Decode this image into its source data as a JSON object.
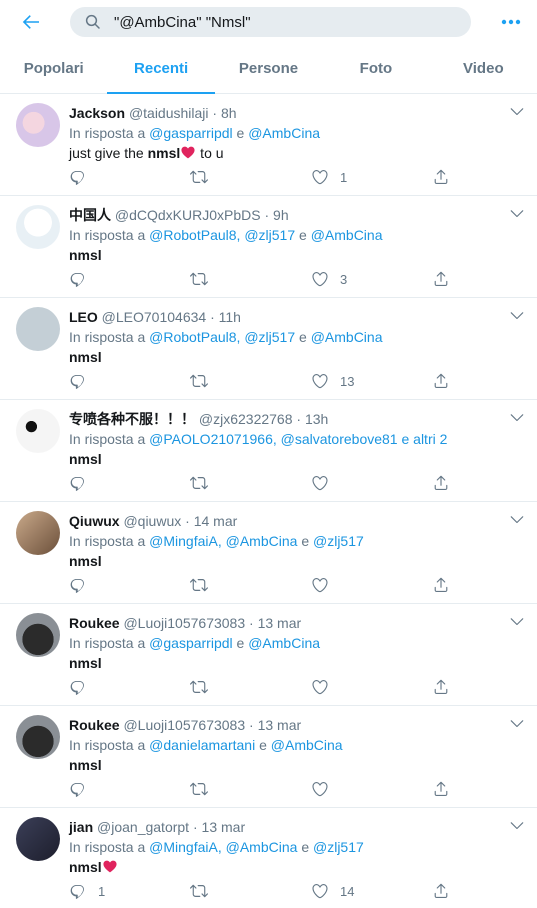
{
  "header": {
    "search_value": "\"@AmbCina\" \"Nmsl\""
  },
  "tabs": [
    {
      "label": "Popolari"
    },
    {
      "label": "Recenti"
    },
    {
      "label": "Persone"
    },
    {
      "label": "Foto"
    },
    {
      "label": "Video"
    }
  ],
  "active_tab": "Recenti",
  "reply_prefix": "In risposta a",
  "tweets": [
    {
      "name": "Jackson",
      "handle": "@taidushilaji",
      "time": "8h",
      "reply_to": [
        "@gasparripdl",
        "e",
        "@AmbCina"
      ],
      "text_pre": "just give the ",
      "text_bold": "nmsl",
      "heart": true,
      "text_post": " to u",
      "replies": "",
      "likes": "1"
    },
    {
      "name": "中国人",
      "handle": "@dCQdxKURJ0xPbDS",
      "time": "9h",
      "reply_to": [
        "@RobotPaul8,",
        "@zlj517",
        "e",
        "@AmbCina"
      ],
      "text_pre": "",
      "text_bold": "nmsl",
      "heart": false,
      "text_post": "",
      "replies": "",
      "likes": "3"
    },
    {
      "name": "LEO",
      "handle": "@LEO70104634",
      "time": "11h",
      "reply_to": [
        "@RobotPaul8,",
        "@zlj517",
        "e",
        "@AmbCina"
      ],
      "text_pre": "",
      "text_bold": "nmsl",
      "heart": false,
      "text_post": "",
      "replies": "",
      "likes": "13"
    },
    {
      "name": "专喷各种不服！！！",
      "handle": "@zjx62322768",
      "time": "13h",
      "reply_to": [
        "@PAOLO21071966,",
        "@salvatorebove81",
        "e altri 2"
      ],
      "text_pre": "",
      "text_bold": "nmsl",
      "heart": false,
      "text_post": "",
      "replies": "",
      "likes": ""
    },
    {
      "name": "Qiuwux",
      "handle": "@qiuwux",
      "time": "14 mar",
      "reply_to": [
        "@MingfaiA,",
        "@AmbCina",
        "e",
        "@zlj517"
      ],
      "text_pre": "",
      "text_bold": "nmsl",
      "heart": false,
      "text_post": "",
      "replies": "",
      "likes": ""
    },
    {
      "name": "Roukee",
      "handle": "@Luoji1057673083",
      "time": "13 mar",
      "reply_to": [
        "@gasparripdl",
        "e",
        "@AmbCina"
      ],
      "text_pre": "",
      "text_bold": "nmsl",
      "heart": false,
      "text_post": "",
      "replies": "",
      "likes": ""
    },
    {
      "name": "Roukee",
      "handle": "@Luoji1057673083",
      "time": "13 mar",
      "reply_to": [
        "@danielamartani",
        "e",
        "@AmbCina"
      ],
      "text_pre": "",
      "text_bold": "nmsl",
      "heart": false,
      "text_post": "",
      "replies": "",
      "likes": ""
    },
    {
      "name": "jian",
      "handle": "@joan_gatorpt",
      "time": "13 mar",
      "reply_to": [
        "@MingfaiA,",
        "@AmbCina",
        "e",
        "@zlj517"
      ],
      "text_pre": "",
      "text_bold": "nmsl",
      "heart": true,
      "text_post": "",
      "replies": "1",
      "likes": "14"
    }
  ],
  "colors": {
    "accent": "#1da1f2",
    "link": "#1b95e0",
    "secondary_text": "#657786",
    "heart": "#e0245e"
  },
  "icons": {
    "back": "arrow-left-icon",
    "search": "search-icon",
    "more": "more-icon",
    "reply": "reply-icon",
    "retweet": "retweet-icon",
    "like": "heart-icon",
    "share": "share-icon",
    "chevron": "chevron-down-icon"
  }
}
